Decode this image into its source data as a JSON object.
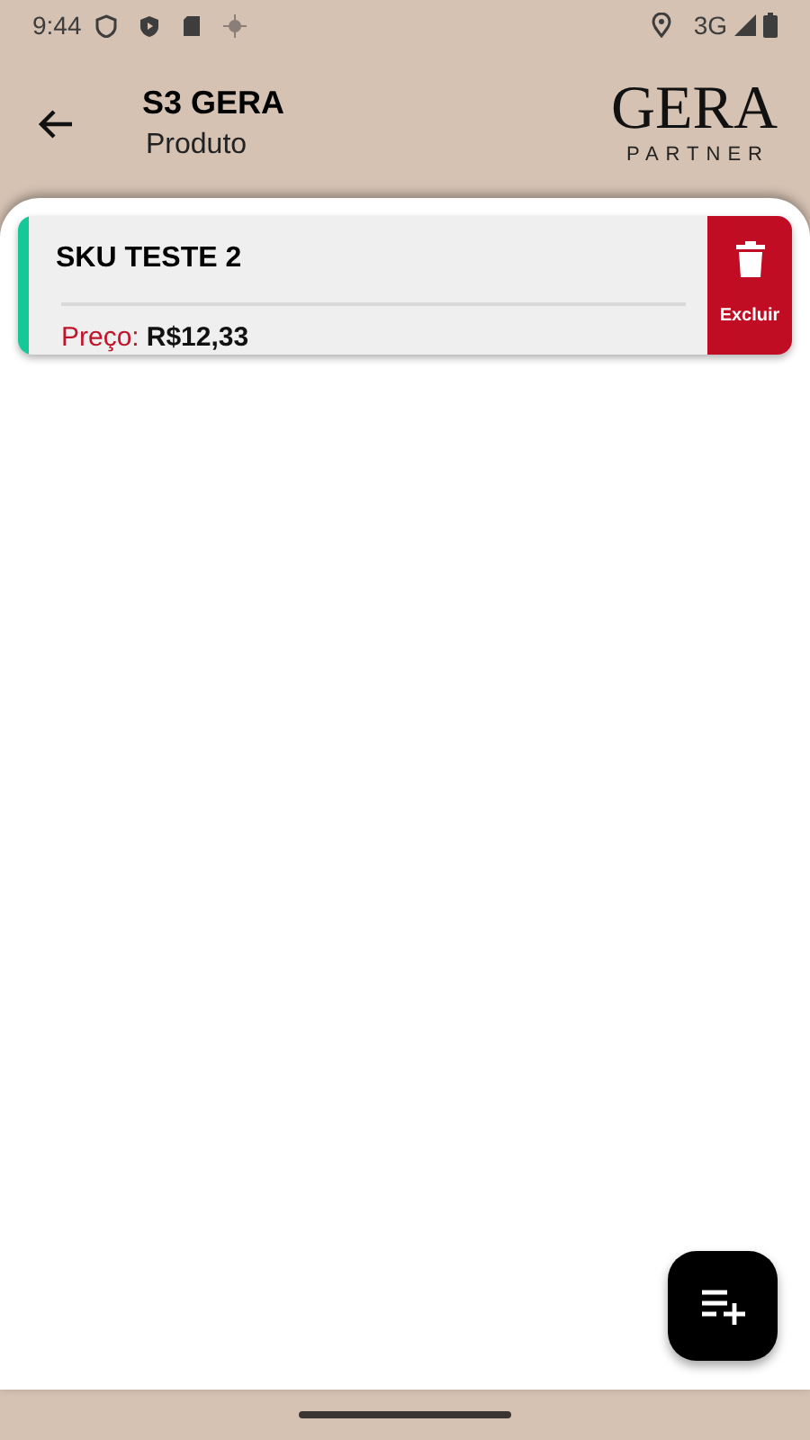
{
  "status_bar": {
    "time": "9:44",
    "network": "3G"
  },
  "header": {
    "title": "S3 GERA",
    "subtitle": "Produto",
    "logo": {
      "name": "GERA",
      "tagline": "PARTNER"
    }
  },
  "products": [
    {
      "name": "SKU TESTE 2",
      "price_label": "Preço:",
      "price": "R$12,33",
      "color": "#14c995",
      "delete_label": "Excluir"
    }
  ]
}
